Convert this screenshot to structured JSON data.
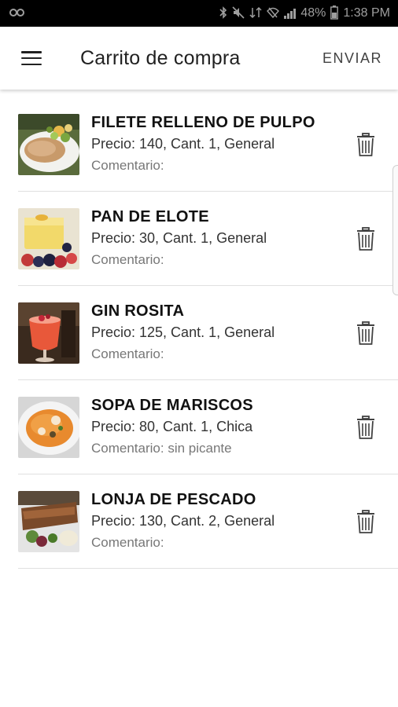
{
  "status_bar": {
    "carrier_icon": "carrier-icon",
    "battery_percent": "48%",
    "time": "1:38 PM"
  },
  "app_bar": {
    "title": "Carrito de compra",
    "send_label": "ENVIAR"
  },
  "cart": {
    "items": [
      {
        "name": "FILETE RELLENO DE PULPO",
        "detail": "Precio: 140, Cant. 1, General",
        "comment": "Comentario:",
        "image": "stuffed-fillet-photo"
      },
      {
        "name": "PAN DE ELOTE",
        "detail": "Precio: 30, Cant. 1, General",
        "comment": "Comentario:",
        "image": "corn-bread-photo"
      },
      {
        "name": "GIN ROSITA",
        "detail": "Precio: 125, Cant. 1, General",
        "comment": "Comentario:",
        "image": "gin-cocktail-photo"
      },
      {
        "name": "SOPA DE MARISCOS",
        "detail": "Precio: 80, Cant. 1, Chica",
        "comment": "Comentario: sin picante",
        "image": "seafood-soup-photo"
      },
      {
        "name": "LONJA DE PESCADO",
        "detail": "Precio: 130, Cant. 2, General",
        "comment": "Comentario:",
        "image": "fish-slice-photo"
      }
    ]
  },
  "colors": {
    "status_bar_bg": "#000000",
    "app_bar_bg": "#ffffff",
    "divider": "#e0e0e0",
    "comment_text": "#777777"
  }
}
